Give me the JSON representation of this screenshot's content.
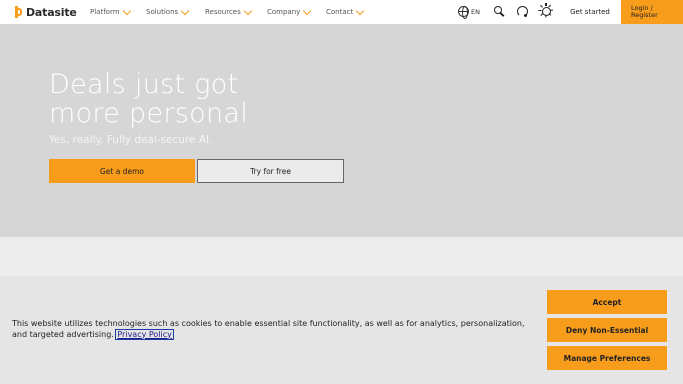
{
  "nav": {
    "logo_text": "Datasite",
    "items": [
      "Platform",
      "Solutions",
      "Resources",
      "Company",
      "Contact"
    ],
    "language": "EN",
    "get_started": "Get started",
    "login_line1": "Login /",
    "login_line2": "Register"
  },
  "hero": {
    "title_line1": "Deals just got",
    "title_line2": "more personal",
    "subtitle": "Yes, really. Fully deal-secure AI.",
    "demo_button": "Get a demo",
    "try_button": "Try for free"
  },
  "cookie": {
    "text": "This website utilizes technologies such as cookies to enable essential site functionality, as well as for analytics, personalization, and targeted advertising.",
    "privacy_link": "Privacy Policy",
    "accept": "Accept",
    "deny": "Deny Non-Essential",
    "manage": "Manage Preferences"
  },
  "colors": {
    "accent": "#f89c1c",
    "hero_bg": "#d6d6d6",
    "cookie_bg": "#e5e5e5"
  }
}
